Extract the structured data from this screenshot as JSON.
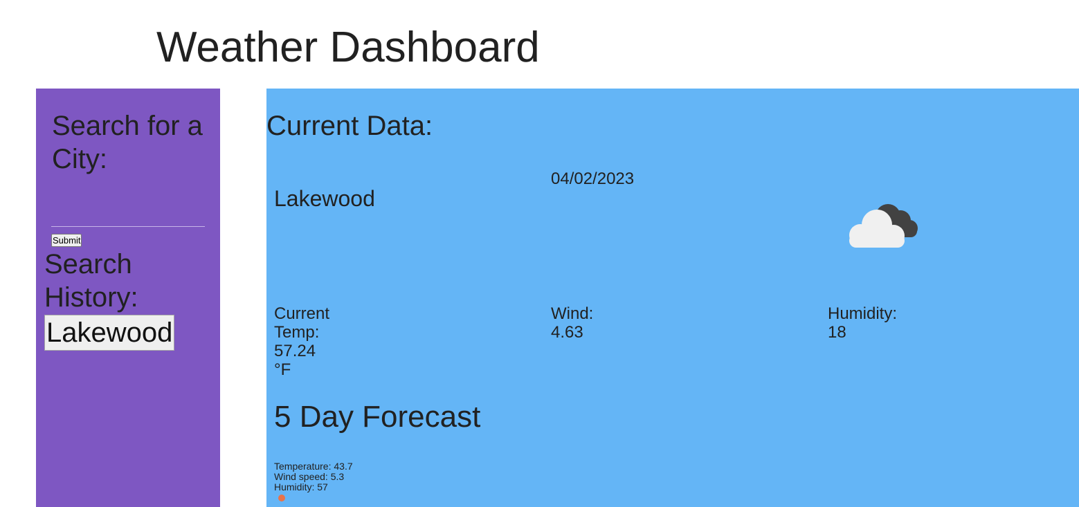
{
  "header": {
    "title": "Weather Dashboard"
  },
  "sidebar": {
    "search_heading": "Search for a City:",
    "city_input": {
      "value": "",
      "placeholder": ""
    },
    "submit_label": "Submit",
    "history_heading": "Search History:",
    "history": [
      "Lakewood"
    ],
    "background": "#7e57c2"
  },
  "main": {
    "background": "#64b5f6",
    "current_heading": "Current Data:",
    "city": "Lakewood",
    "date": "04/02/2023",
    "icon": "cloudy-icon",
    "temp": {
      "label": "Current Temp:",
      "value": "57.24",
      "unit": "°F"
    },
    "wind": {
      "label": "Wind:",
      "value": "4.63"
    },
    "humidity": {
      "label": "Humidity:",
      "value": "18"
    },
    "forecast_heading": "5 Day Forecast",
    "forecast": [
      {
        "temperature": "Temperature: 43.7",
        "wind": "Wind speed: 5.3",
        "humidity": "Humidity: 57"
      }
    ]
  }
}
